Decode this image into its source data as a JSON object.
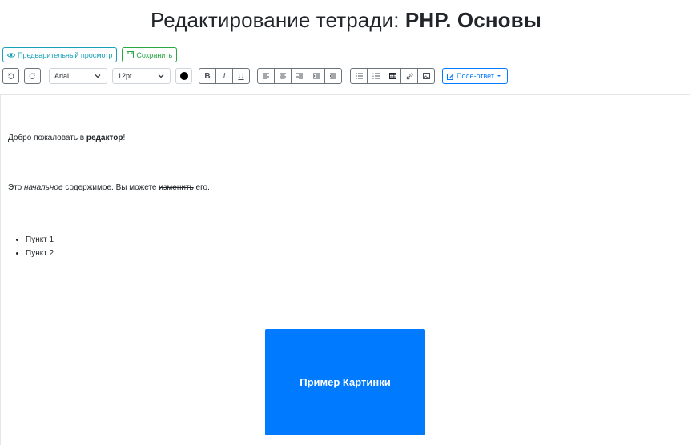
{
  "header": {
    "title_prefix": "Редактирование тетради: ",
    "title_name": "PHP. Основы"
  },
  "actions": {
    "preview_label": "Предварительный просмотр",
    "save_label": "Сохранить"
  },
  "toolbar": {
    "font_family": "Arial",
    "font_size": "12pt",
    "text_color": "#000000",
    "bold_label": "B",
    "italic_label": "I",
    "underline_label": "U",
    "answer_field_label": "Поле-ответ"
  },
  "content": {
    "p1_prefix": "Добро пожаловать в ",
    "p1_bold": "редактор",
    "p1_suffix": "!",
    "p2_prefix": "Это ",
    "p2_italic": "начальное",
    "p2_middle": " содержимое. Вы можете ",
    "p2_strike": "изменить",
    "p2_suffix": " его.",
    "list_items": [
      "Пункт 1",
      "Пункт 2"
    ],
    "image_label": "Пример Картинки"
  },
  "colors": {
    "info": "#17a2b8",
    "success": "#28a745",
    "primary": "#007bff"
  }
}
